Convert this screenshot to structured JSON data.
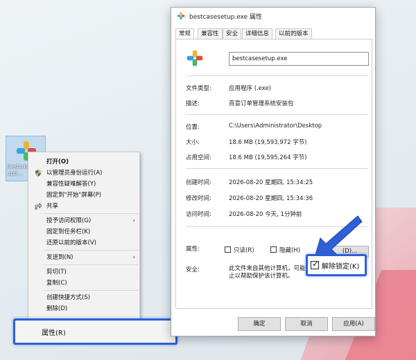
{
  "desktop": {
    "icon_label_line1": "bestcase",
    "icon_label_line2": "upd..."
  },
  "context_menu": {
    "items": [
      {
        "label": "打开(O)",
        "bold": true
      },
      {
        "label": "以管理员身份运行(A)"
      },
      {
        "label": "兼容性疑难解答(Y)"
      },
      {
        "label": "固定到\"开始\"屏幕(P)"
      },
      {
        "label": "共享"
      },
      {
        "label": "授予访问权限(G)"
      },
      {
        "label": "固定到任务栏(K)"
      },
      {
        "label": "还原以前的版本(V)"
      },
      {
        "label": "发送到(N)"
      },
      {
        "label": "剪切(T)"
      },
      {
        "label": "复制(C)"
      },
      {
        "label": "创建快捷方式(S)"
      },
      {
        "label": "删除(D)"
      },
      {
        "label": "属性(R)"
      }
    ]
  },
  "dialog": {
    "title": "bestcasesetup.exe 属性",
    "tabs": [
      "常规",
      "兼容性",
      "安全",
      "详细信息",
      "以前的版本"
    ],
    "filename": "bestcasesetup.exe",
    "rows": {
      "file_type_label": "文件类型:",
      "file_type_value": "应用程序 (.exe)",
      "desc_label": "描述:",
      "desc_value": "百意订单管理系统安装包",
      "location_label": "位置:",
      "location_value": "C:\\Users\\Administrator\\Desktop",
      "size_label": "大小:",
      "size_value": "18.6 MB (19,593,972 字节)",
      "disk_size_label": "占用空间:",
      "disk_size_value": "18.6 MB (19,595,264 字节)",
      "created_label": "创建时间:",
      "created_value": "2026-08-20 星期四, 15:34:25",
      "modified_label": "修改时间:",
      "modified_value": "2026-08-20 星期四, 15:34:36",
      "accessed_label": "访问时间:",
      "accessed_value": "2026-08-20 今天, 1分钟前",
      "attr_label": "属性:",
      "readonly_label": "只读(R)",
      "hidden_label": "隐藏(H)",
      "advanced_label": "(D)...",
      "security_label": "安全:",
      "security_text": "此文件来自其他计算机，可能被阻止以帮助保护该计算机。"
    },
    "unlock_label": "解除锁定(K)",
    "buttons": {
      "ok": "确定",
      "cancel": "取消",
      "apply": "应用(A)"
    }
  },
  "colors": {
    "highlight": "#2e5fd6"
  }
}
